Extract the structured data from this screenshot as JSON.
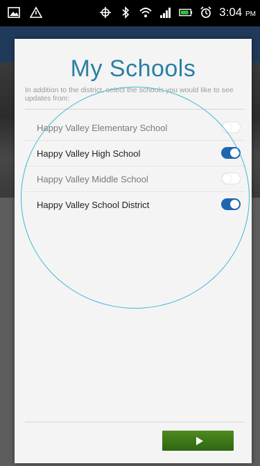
{
  "status_bar": {
    "icons_left": [
      "gallery-icon",
      "warning-icon"
    ],
    "icons_right": [
      "gps-icon",
      "bluetooth-icon",
      "wifi-icon",
      "signal-icon",
      "battery-icon",
      "alarm-icon"
    ],
    "time": "3:04",
    "ampm": "PM"
  },
  "modal": {
    "title": "My Schools",
    "subtitle": "In addition to the district, select the schools you would like to see updates from:",
    "schools": [
      {
        "name": "Happy Valley Elementary School",
        "enabled": false
      },
      {
        "name": "Happy Valley High School",
        "enabled": true
      },
      {
        "name": "Happy Valley Middle School",
        "enabled": false
      },
      {
        "name": "Happy Valley School District",
        "enabled": true
      }
    ],
    "next_button_icon": "play-icon"
  },
  "colors": {
    "title": "#2a7fa6",
    "toggle_on": "#1e66b0",
    "highlight_circle": "#3fb8d4",
    "next_button": "#3f7a18"
  }
}
